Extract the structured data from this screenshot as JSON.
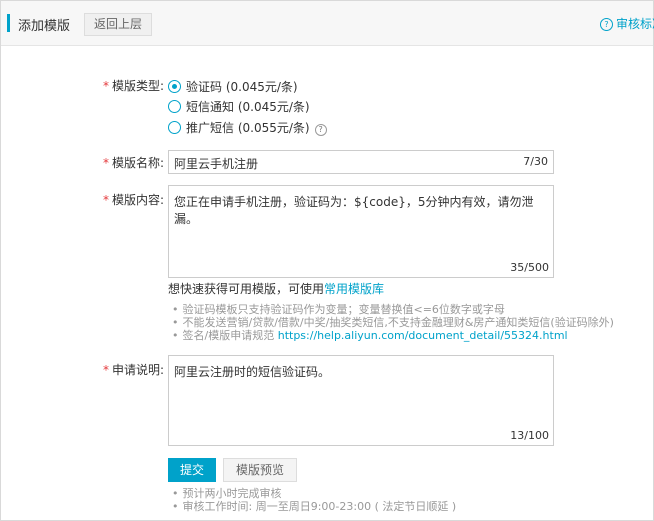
{
  "header": {
    "title": "添加模版",
    "back_label": "返回上层",
    "help_label": "审核标准"
  },
  "form": {
    "type": {
      "label": "模版类型:",
      "options": [
        {
          "label": "验证码 (0.045元/条)",
          "selected": true
        },
        {
          "label": "短信通知 (0.045元/条)",
          "selected": false
        },
        {
          "label": "推广短信 (0.055元/条)",
          "selected": false
        }
      ]
    },
    "name": {
      "label": "模版名称:",
      "value": "阿里云手机注册",
      "counter": "7/30"
    },
    "content": {
      "label": "模版内容:",
      "value": "您正在申请手机注册，验证码为：${code}，5分钟内有效，请勿泄漏。",
      "counter": "35/500"
    },
    "quick_text": "想快速获得可用模版，可使用",
    "quick_link": "常用模版库",
    "tips": [
      "验证码模板只支持验证码作为变量；变量替换值<=6位数字或字母",
      "不能发送营销/贷款/借款/中奖/抽奖类短信,不支持金融理财&房产通知类短信(验证码除外)"
    ],
    "tip_sign_prefix": "签名/模版申请规范",
    "tip_sign_link": "https://help.aliyun.com/document_detail/55324.html",
    "desc": {
      "label": "申请说明:",
      "value": "阿里云注册时的短信验证码。",
      "counter": "13/100"
    },
    "required_mark": "*"
  },
  "actions": {
    "submit_label": "提交",
    "preview_label": "模版预览"
  },
  "footer_notes": [
    "预计两小时完成审核",
    "审核工作时间: 周一至周日9:00-23:00 ( 法定节日顺延 )"
  ],
  "colors": {
    "accent": "#00a2ca",
    "required": "#e4393c",
    "muted": "#999999"
  }
}
